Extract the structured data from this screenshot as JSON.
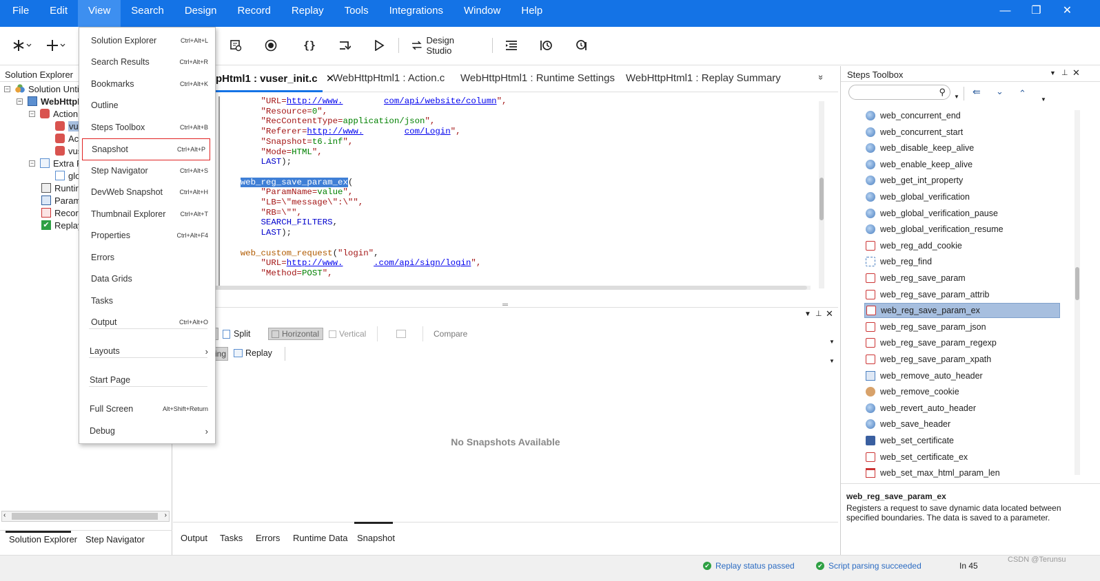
{
  "menubar": {
    "items": [
      "File",
      "Edit",
      "View",
      "Search",
      "Design",
      "Record",
      "Replay",
      "Tools",
      "Integrations",
      "Window",
      "Help"
    ],
    "active": "View"
  },
  "window_controls": {
    "minimize": "—",
    "restore": "❐",
    "close": "✕"
  },
  "toolbar": {
    "design_studio_label": "Design Studio"
  },
  "view_menu": {
    "items": [
      {
        "label": "Solution Explorer",
        "shortcut": "Ctrl+Alt+L"
      },
      {
        "label": "Search Results",
        "shortcut": "Ctrl+Alt+R"
      },
      {
        "label": "Bookmarks",
        "shortcut": "Ctrl+Alt+K"
      },
      {
        "label": "Outline",
        "shortcut": ""
      },
      {
        "label": "Steps Toolbox",
        "shortcut": "Ctrl+Alt+B"
      },
      {
        "label": "Snapshot",
        "shortcut": "Ctrl+Alt+P"
      },
      {
        "label": "Step Navigator",
        "shortcut": "Ctrl+Alt+S"
      },
      {
        "label": "DevWeb Snapshot",
        "shortcut": "Ctrl+Alt+H"
      },
      {
        "label": "Thumbnail Explorer",
        "shortcut": "Ctrl+Alt+T"
      },
      {
        "label": "Properties",
        "shortcut": "Ctrl+Alt+F4"
      },
      {
        "label": "Errors",
        "shortcut": ""
      },
      {
        "label": "Data Grids",
        "shortcut": ""
      },
      {
        "label": "Tasks",
        "shortcut": ""
      },
      {
        "label": "Output",
        "shortcut": "Ctrl+Alt+O"
      },
      {
        "label": "Layouts",
        "shortcut": "›"
      },
      {
        "label": "Start Page",
        "shortcut": ""
      },
      {
        "label": "Full Screen",
        "shortcut": "Alt+Shift+Return"
      },
      {
        "label": "Debug",
        "shortcut": "›"
      }
    ]
  },
  "solution_explorer": {
    "title": "Solution Explorer",
    "tree": [
      "Solution Untit",
      "WebHttpH",
      "Action.",
      "vus",
      "Acti",
      "vus",
      "Extra F",
      "glo",
      "Runtir",
      "Param",
      "Recor",
      "Replay"
    ],
    "tabs": [
      "Solution Explorer",
      "Step Navigator"
    ]
  },
  "editor": {
    "tabs": [
      "pHtml1 : vuser_init.c",
      "WebHttpHtml1 : Action.c",
      "WebHttpHtml1 : Runtime Settings",
      "WebHttpHtml1 : Replay Summary"
    ],
    "close_glyph": "✕",
    "overflow_glyph": "»"
  },
  "code": {
    "l1_key": "\"URL=",
    "l1_url1": "http://www.",
    "l1_url2": "com/api/website/column",
    "l1_end": "\",",
    "l2": "\"Resource=",
    "l2_val": "0",
    "l2_end": "\",",
    "l3": "\"RecContentType=",
    "l3_val": "application/json",
    "l3_end": "\",",
    "l4": "\"Referer=",
    "l4_url1": "http://www.",
    "l4_url2": "com/Login",
    "l4_end": "\",",
    "l5": "\"Snapshot=",
    "l5_val": "t6.inf",
    "l5_end": "\",",
    "l6": "\"Mode=",
    "l6_val": "HTML",
    "l6_end": "\",",
    "l7": "LAST",
    "fn1": "web_reg_save_param_ex",
    "p1": "\"ParamName=",
    "p1_val": "value",
    "p1_end": "\",",
    "p2": "\"LB=\\\"message\\\":\\\"\",",
    "p3": "\"RB=\\\"\",",
    "p4": "SEARCH_FILTERS",
    "p5": "LAST",
    "fn2": "web_custom_request",
    "fn2_arg": "\"login\"",
    "c1": "\"URL=",
    "c1_url1": "http://www.",
    "c1_url2": ".com/api/sign/login",
    "c1_end": "\",",
    "c2": "\"Method=",
    "c2_val": "POST",
    "c2_end": "\","
  },
  "snapshot": {
    "split_label": "Split",
    "horizontal_label": "Horizontal",
    "vertical_label": "Vertical",
    "compare_label": "Compare",
    "recording_label": "ing",
    "replay_label": "Replay",
    "empty_message": "No Snapshots Available"
  },
  "bottom_tabs": [
    "Output",
    "Tasks",
    "Errors",
    "Runtime Data",
    "Snapshot"
  ],
  "steps_toolbox": {
    "title": "Steps Toolbox",
    "search_placeholder": "",
    "items": [
      {
        "label": "web_concurrent_end",
        "icon": "globe"
      },
      {
        "label": "web_concurrent_start",
        "icon": "globe"
      },
      {
        "label": "web_disable_keep_alive",
        "icon": "globe"
      },
      {
        "label": "web_enable_keep_alive",
        "icon": "globe"
      },
      {
        "label": "web_get_int_property",
        "icon": "globe"
      },
      {
        "label": "web_global_verification",
        "icon": "globe"
      },
      {
        "label": "web_global_verification_pause",
        "icon": "globe"
      },
      {
        "label": "web_global_verification_resume",
        "icon": "globe"
      },
      {
        "label": "web_reg_add_cookie",
        "icon": "reg"
      },
      {
        "label": "web_reg_find",
        "icon": "find"
      },
      {
        "label": "web_reg_save_param",
        "icon": "reg"
      },
      {
        "label": "web_reg_save_param_attrib",
        "icon": "reg"
      },
      {
        "label": "web_reg_save_param_ex",
        "icon": "reg"
      },
      {
        "label": "web_reg_save_param_json",
        "icon": "reg"
      },
      {
        "label": "web_reg_save_param_regexp",
        "icon": "reg"
      },
      {
        "label": "web_reg_save_param_xpath",
        "icon": "reg"
      },
      {
        "label": "web_remove_auto_header",
        "icon": "remove"
      },
      {
        "label": "web_remove_cookie",
        "icon": "cookie"
      },
      {
        "label": "web_revert_auto_header",
        "icon": "globe"
      },
      {
        "label": "web_save_header",
        "icon": "globe"
      },
      {
        "label": "web_set_certificate",
        "icon": "cert"
      },
      {
        "label": "web_set_certificate_ex",
        "icon": "reg"
      },
      {
        "label": "web_set_max_html_param_len",
        "icon": "calendar"
      }
    ],
    "selected_index": 12,
    "desc_title": "web_reg_save_param_ex",
    "desc_text": "Registers a request to save dynamic data located between specified boundaries. The data is saved to a parameter."
  },
  "statusbar": {
    "replay_status": "Replay status passed",
    "script_status": "Script parsing succeeded",
    "line": "In 45",
    "watermark": "CSDN @Terunsu"
  }
}
